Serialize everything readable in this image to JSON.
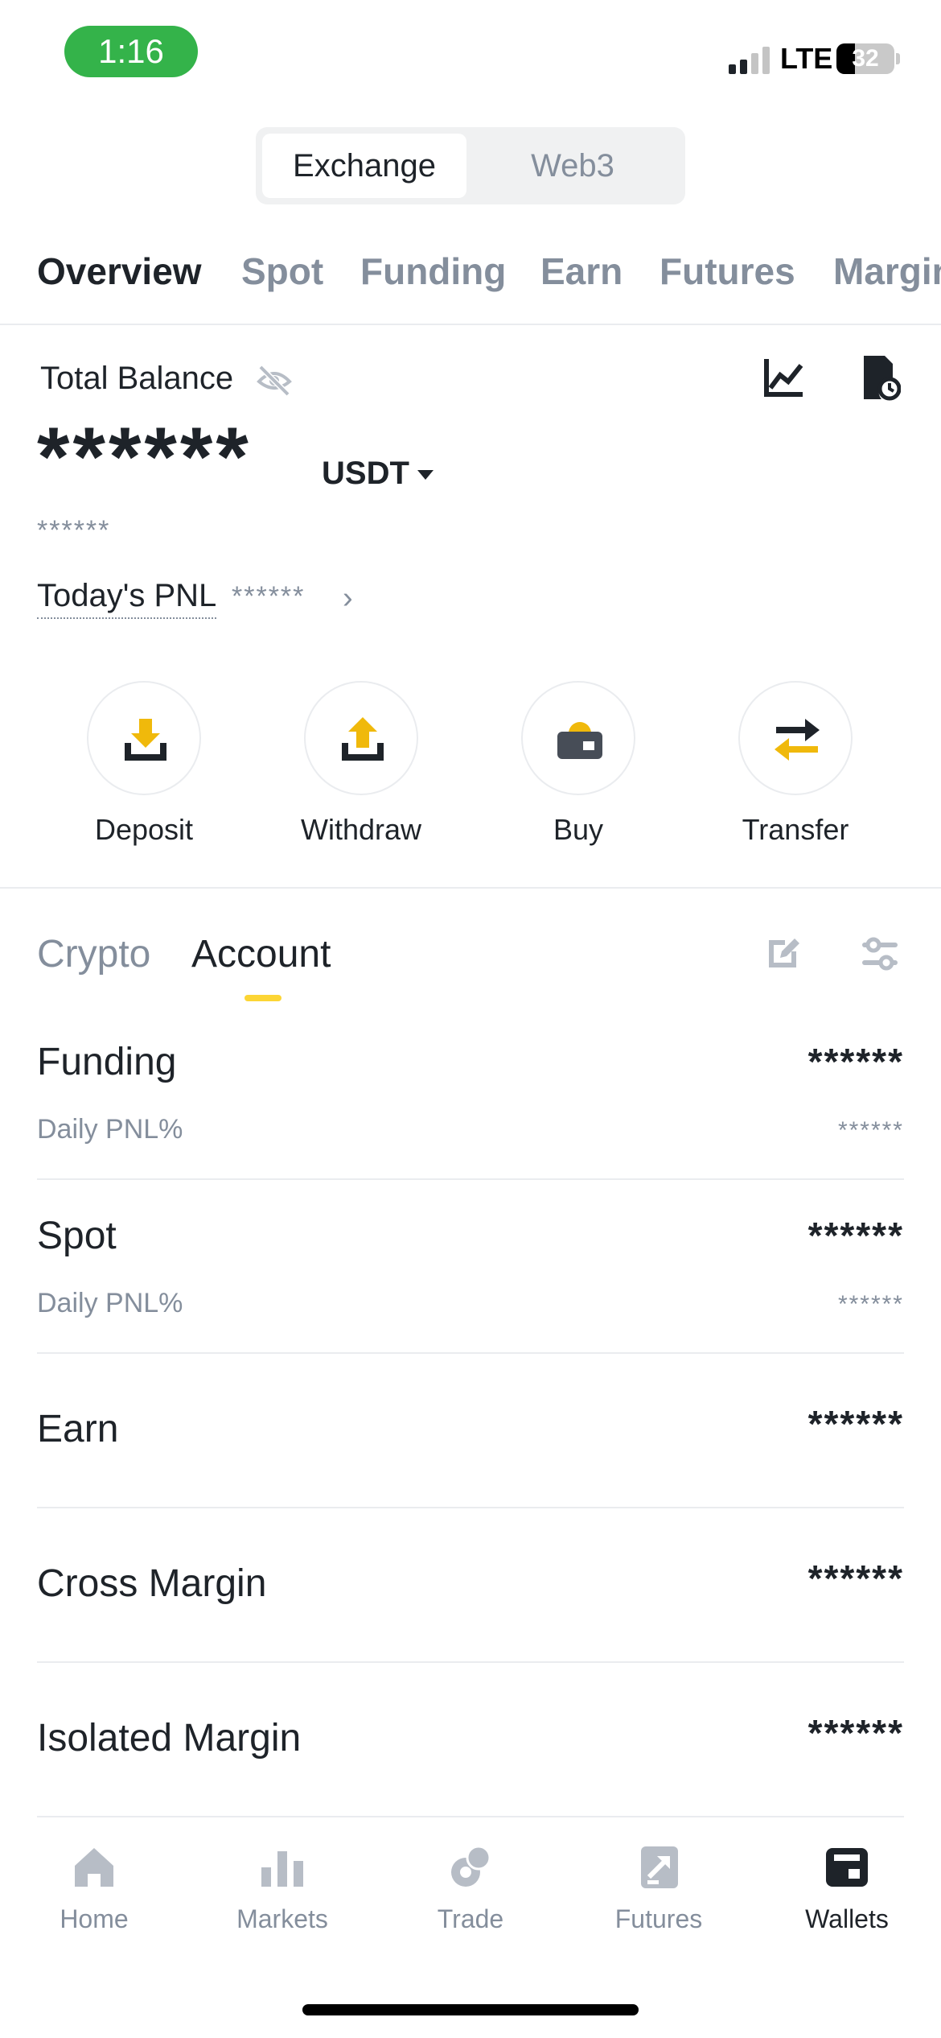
{
  "status_bar": {
    "time": "1:16",
    "network": "LTE",
    "battery": "32",
    "battery_level": 0.32
  },
  "segment": {
    "active": "Exchange",
    "inactive": "Web3"
  },
  "top_tabs": [
    "Overview",
    "Spot",
    "Funding",
    "Earn",
    "Futures",
    "Margin"
  ],
  "balance": {
    "label": "Total Balance",
    "value": "******",
    "currency": "USDT",
    "sub_value": "******",
    "pnl_label": "Today's PNL",
    "pnl_value": "******"
  },
  "actions": [
    {
      "label": "Deposit",
      "icon": "deposit-icon"
    },
    {
      "label": "Withdraw",
      "icon": "withdraw-icon"
    },
    {
      "label": "Buy",
      "icon": "wallet-buy-icon"
    },
    {
      "label": "Transfer",
      "icon": "transfer-arrows-icon"
    }
  ],
  "sub_tabs": {
    "crypto": "Crypto",
    "account": "Account"
  },
  "accounts": [
    {
      "name": "Funding",
      "value": "******",
      "sub_label": "Daily PNL%",
      "sub_value": "******"
    },
    {
      "name": "Spot",
      "value": "******",
      "sub_label": "Daily PNL%",
      "sub_value": "******"
    },
    {
      "name": "Earn",
      "value": "******"
    },
    {
      "name": "Cross Margin",
      "value": "******"
    },
    {
      "name": "Isolated Margin",
      "value": "******"
    }
  ],
  "bottom_nav": [
    {
      "label": "Home",
      "icon": "home-icon"
    },
    {
      "label": "Markets",
      "icon": "bar-chart-icon"
    },
    {
      "label": "Trade",
      "icon": "trade-icon"
    },
    {
      "label": "Futures",
      "icon": "futures-icon"
    },
    {
      "label": "Wallets",
      "icon": "wallet-icon",
      "active": true
    }
  ],
  "colors": {
    "accent": "#FCD535",
    "icon_gold": "#F0B90B",
    "text_primary": "#1E2329",
    "text_secondary": "#848E9C",
    "status_green": "#34B34A"
  }
}
